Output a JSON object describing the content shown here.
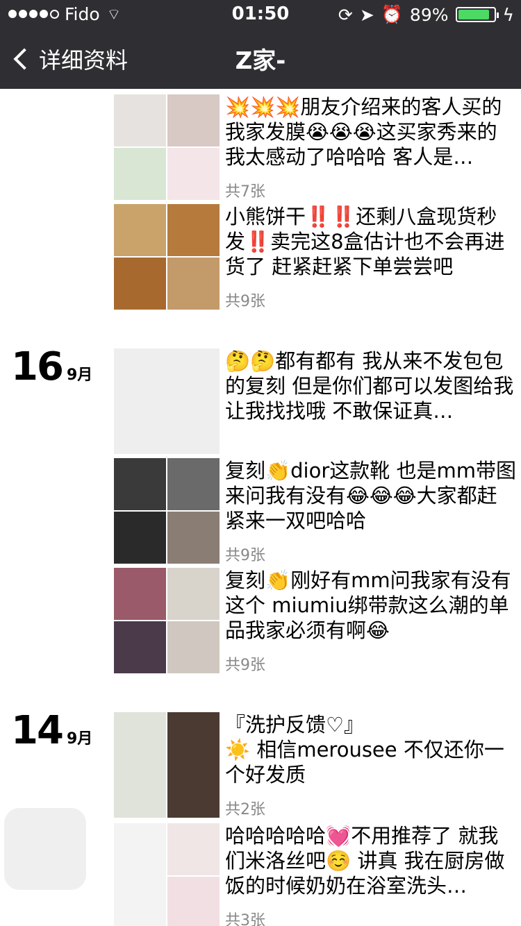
{
  "status": {
    "carrier": "Fido",
    "time": "01:50",
    "battery": "89%",
    "battery_level": 0.89,
    "icons": [
      "signal-icon",
      "wifi-icon",
      "rotation-lock-icon",
      "location-arrow-icon",
      "alarm-icon",
      "battery-icon",
      "charging-bolt-icon"
    ]
  },
  "nav": {
    "back_label": "详细资料",
    "title": "Z家-"
  },
  "groups": [
    {
      "day": "",
      "month": "",
      "posts": [
        {
          "text": "💥💥💥朋友介绍来的客人买的我家发膜😭😭😭这买家秀来的我太感动了哈哈哈 客人是…",
          "count": "共7张",
          "colors": [
            "#e6e2df",
            "#d8c9c4",
            "#d9e6d4",
            "#f3e5e8"
          ]
        },
        {
          "text": "小熊饼干‼️‼️还剩八盒现货秒发‼️卖完这8盒估计也不会再进货了 赶紧赶紧下单尝尝吧",
          "count": "共9张",
          "colors": [
            "#c9a36a",
            "#b67a3c",
            "#a8692e",
            "#c39a6a"
          ]
        }
      ]
    },
    {
      "day": "16",
      "month": "9月",
      "posts": [
        {
          "text": "🤔🤔都有都有 我从来不发包包的复刻 但是你们都可以发图给我让我找找哦 不敢保证真…",
          "count": "",
          "colors": [
            "#efeeee"
          ]
        },
        {
          "text": "复刻👏dior这款靴 也是mm带图来问我有没有😂😂😂大家都赶紧来一双吧哈哈",
          "count": "共9张",
          "colors": [
            "#3a3a3a",
            "#6a6a6a",
            "#2a2a2a",
            "#8a7d74"
          ]
        },
        {
          "text": "复刻👏刚好有mm问我家有没有这个 miumiu绑带款这么潮的单品我家必须有啊😂",
          "count": "共9张",
          "colors": [
            "#9a5a6a",
            "#d8d4cc",
            "#4a3a4a",
            "#d0c8c0"
          ]
        }
      ]
    },
    {
      "day": "14",
      "month": "9月",
      "posts": [
        {
          "text": "『洗护反馈♡』\n☀️ 相信merousee 不仅还你一个好发质",
          "count": "共2张",
          "colors": [
            "#dfe3d9",
            "#4a3a32"
          ]
        },
        {
          "text": "哈哈哈哈哈💓不用推荐了 就我们米洛丝吧☺️ 讲真 我在厨房做饭的时候奶奶在浴室洗头…",
          "count": "共3张",
          "colors": [
            "#f3f3f3",
            "#f0e6e6",
            "#f2dfe3"
          ]
        }
      ]
    }
  ]
}
